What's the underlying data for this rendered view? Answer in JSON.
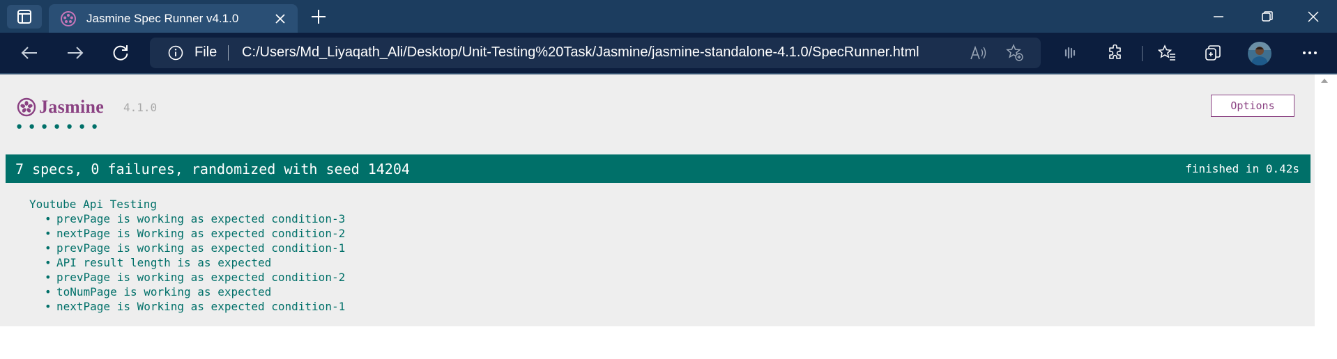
{
  "browser": {
    "tab_title": "Jasmine Spec Runner v4.1.0",
    "site_label": "File",
    "url": "C:/Users/Md_Liyaqath_Ali/Desktop/Unit-Testing%20Task/Jasmine/jasmine-standalone-4.1.0/SpecRunner.html",
    "icons": [
      "tab-actions-icon",
      "jasmine-favicon-icon",
      "close-tab-icon",
      "new-tab-icon",
      "minimize-icon",
      "maximize-icon",
      "close-window-icon",
      "back-icon",
      "forward-icon",
      "refresh-icon",
      "info-icon",
      "read-aloud-icon",
      "add-favorite-icon",
      "extension-icon",
      "puzzle-icon",
      "favorites-icon",
      "collections-icon",
      "more-icon"
    ]
  },
  "jasmine": {
    "logo_text": "Jasmine",
    "version": "4.1.0",
    "options_label": "Options",
    "dots": [
      "•",
      "•",
      "•",
      "•",
      "•",
      "•",
      "•"
    ],
    "summary": "7 specs, 0 failures, randomized with seed 14204",
    "finished": "finished in 0.42s",
    "suite": {
      "name": "Youtube Api Testing",
      "specs": [
        "prevPage is working as expected condition-3",
        "nextPage is Working as expected condition-2",
        "prevPage is working as expected condition-1",
        "API result length is as expected",
        "prevPage is working as expected condition-2",
        "toNumPage is working as expected",
        "nextPage is Working as expected condition-1"
      ]
    }
  },
  "colors": {
    "titlebar": "#1c3d5f",
    "toolbar": "#0c1e3e",
    "jasmine_purple": "#8a4182",
    "passed_green": "#007069",
    "page_bg": "#eeeeee"
  }
}
